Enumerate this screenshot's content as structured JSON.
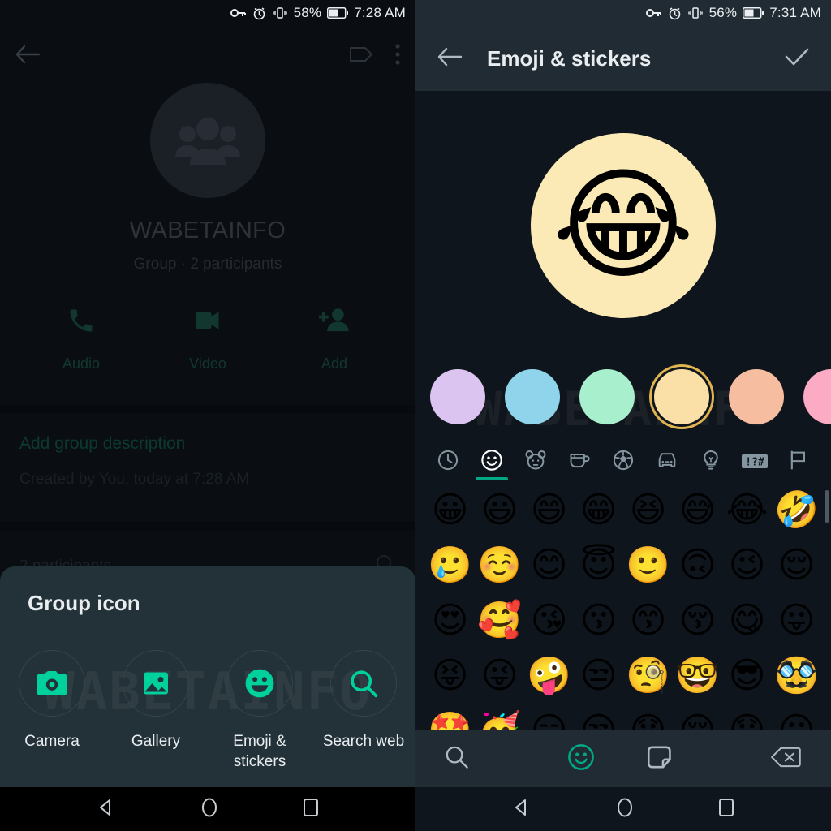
{
  "left": {
    "status": {
      "battery_percent": "58%",
      "time": "7:28 AM",
      "icons": [
        "key-icon",
        "alarm-icon",
        "vibrate-icon",
        "battery-icon"
      ]
    },
    "appbar": {
      "back": "back-arrow-icon",
      "label_icon": "tag-icon",
      "overflow": "more-vert-icon"
    },
    "group_name": "WABETAINFO",
    "group_subtitle": "Group · 2 participants",
    "actions": [
      {
        "label": "Audio",
        "icon": "phone-icon"
      },
      {
        "label": "Video",
        "icon": "video-camera-icon"
      },
      {
        "label": "Add",
        "icon": "person-add-icon"
      }
    ],
    "description_placeholder": "Add group description",
    "created_text": "Created by You, today at 7:28 AM",
    "participants_header": "2 participants",
    "participants_search_icon": "search-icon",
    "sheet": {
      "title": "Group icon",
      "options": [
        {
          "label": "Camera",
          "icon": "camera-icon"
        },
        {
          "label": "Gallery",
          "icon": "gallery-icon"
        },
        {
          "label": "Emoji & stickers",
          "icon": "emoji-icon"
        },
        {
          "label": "Search web",
          "icon": "search-icon"
        }
      ]
    },
    "watermark": "WABETAINFO"
  },
  "right": {
    "status": {
      "battery_percent": "56%",
      "time": "7:31 AM",
      "icons": [
        "key-icon",
        "alarm-icon",
        "vibrate-icon",
        "battery-icon"
      ]
    },
    "appbar": {
      "back": "back-arrow-icon",
      "title": "Emoji & stickers",
      "confirm": "check-icon"
    },
    "preview": {
      "emoji": "😂",
      "background_color": "#fbeab5"
    },
    "watermark": "WABETAINFO",
    "swatches": [
      {
        "color": "#dcc4f0",
        "selected": false
      },
      {
        "color": "#8fd4ea",
        "selected": false
      },
      {
        "color": "#a7efcd",
        "selected": false
      },
      {
        "color": "#fadfa6",
        "selected": true
      },
      {
        "color": "#f7bda0",
        "selected": false
      },
      {
        "color": "#fbabc4",
        "selected": false
      },
      {
        "color": "#d3dae0",
        "selected": false
      }
    ],
    "categories": [
      {
        "name": "recent",
        "icon": "clock-icon",
        "selected": false
      },
      {
        "name": "smileys",
        "icon": "smiley-icon",
        "selected": true
      },
      {
        "name": "animals",
        "icon": "bear-icon",
        "selected": false
      },
      {
        "name": "food",
        "icon": "cup-icon",
        "selected": false
      },
      {
        "name": "activities",
        "icon": "soccer-ball-icon",
        "selected": false
      },
      {
        "name": "travel",
        "icon": "car-icon",
        "selected": false
      },
      {
        "name": "objects",
        "icon": "lightbulb-icon",
        "selected": false
      },
      {
        "name": "symbols",
        "icon": "symbols-icon",
        "selected": false
      },
      {
        "name": "flags",
        "icon": "flag-icon",
        "selected": false
      }
    ],
    "accent_color": "#00a884",
    "emoji_rows": [
      [
        "😀",
        "😃",
        "😄",
        "😁",
        "😆",
        "😅",
        "😂",
        "🤣"
      ],
      [
        "🥲",
        "☺️",
        "😊",
        "😇",
        "🙂",
        "🙃",
        "😉",
        "😌"
      ],
      [
        "😍",
        "🥰",
        "😘",
        "😗",
        "😙",
        "😚",
        "😋",
        "😛"
      ],
      [
        "😝",
        "😜",
        "🤪",
        "😒",
        "🧐",
        "🤓",
        "😎",
        "🥸"
      ],
      [
        "🤩",
        "🥳",
        "😏",
        "😒",
        "😞",
        "😔",
        "😟",
        "😕"
      ]
    ],
    "keyboard_bar": [
      {
        "name": "search",
        "icon": "search-icon",
        "selected": false
      },
      {
        "name": "emoji",
        "icon": "emoji-icon",
        "selected": true
      },
      {
        "name": "stickers",
        "icon": "sticker-icon",
        "selected": false
      },
      {
        "name": "backspace",
        "icon": "backspace-icon",
        "selected": false
      }
    ]
  },
  "navbar": {
    "back": "nav-back-icon",
    "home": "nav-home-icon",
    "recents": "nav-recents-icon"
  }
}
